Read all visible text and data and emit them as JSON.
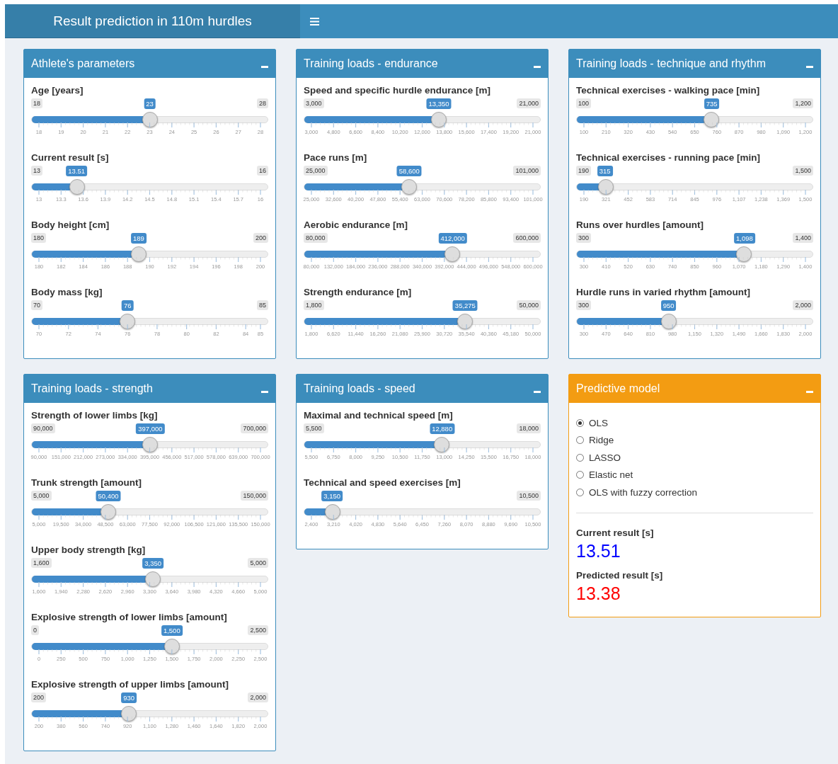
{
  "header": {
    "title": "Result prediction in 110m hurdles"
  },
  "panels": [
    {
      "kind": "sliders",
      "title": "Athlete's parameters",
      "sliders": [
        {
          "label": "Age [years]",
          "min": "18",
          "max": "28",
          "value": "23",
          "level": 0.5,
          "ticks": [
            "18",
            "19",
            "20",
            "21",
            "22",
            "23",
            "24",
            "25",
            "26",
            "27",
            "28"
          ]
        },
        {
          "label": "Current result [s]",
          "min": "13",
          "max": "16",
          "value": "13.51",
          "level": 0.17,
          "ticks": [
            "13",
            "13.3",
            "13.6",
            "13.9",
            "14.2",
            "14.5",
            "14.8",
            "15.1",
            "15.4",
            "15.7",
            "16"
          ]
        },
        {
          "label": "Body height [cm]",
          "min": "180",
          "max": "200",
          "value": "189",
          "level": 0.45,
          "ticks": [
            "180",
            "182",
            "184",
            "186",
            "188",
            "190",
            "192",
            "194",
            "196",
            "198",
            "200"
          ]
        },
        {
          "label": "Body mass [kg]",
          "min": "70",
          "max": "85",
          "value": "76",
          "level": 0.4,
          "ticks": [
            "70",
            "72",
            "74",
            "76",
            "78",
            "80",
            "82",
            "84",
            "85"
          ]
        }
      ]
    },
    {
      "kind": "sliders",
      "title": "Training loads - endurance",
      "sliders": [
        {
          "label": "Speed and specific hurdle endurance [m]",
          "min": "3,000",
          "max": "21,000",
          "value": "13,350",
          "level": 0.575,
          "ticks": [
            "3,000",
            "4,800",
            "6,600",
            "8,400",
            "10,200",
            "12,000",
            "13,800",
            "15,600",
            "17,400",
            "19,200",
            "21,000"
          ]
        },
        {
          "label": "Pace runs [m]",
          "min": "25,000",
          "max": "101,000",
          "value": "58,600",
          "level": 0.442,
          "ticks": [
            "25,000",
            "32,600",
            "40,200",
            "47,800",
            "55,400",
            "63,000",
            "70,600",
            "78,200",
            "85,800",
            "93,400",
            "101,000"
          ]
        },
        {
          "label": "Aerobic endurance [m]",
          "min": "80,000",
          "max": "600,000",
          "value": "412,000",
          "level": 0.638,
          "ticks": [
            "80,000",
            "132,000",
            "184,000",
            "236,000",
            "288,000",
            "340,000",
            "392,000",
            "444,000",
            "496,000",
            "548,000",
            "600,000"
          ]
        },
        {
          "label": "Strength endurance [m]",
          "min": "1,800",
          "max": "50,000",
          "value": "35,275",
          "level": 0.6945,
          "ticks": [
            "1,800",
            "6,620",
            "11,440",
            "16,260",
            "21,080",
            "25,900",
            "30,720",
            "35,540",
            "40,360",
            "45,180",
            "50,000"
          ]
        }
      ]
    },
    {
      "kind": "sliders",
      "title": "Training loads - technique and rhythm",
      "sliders": [
        {
          "label": "Technical exercises - walking pace [min]",
          "min": "100",
          "max": "1,200",
          "value": "735",
          "level": 0.577,
          "ticks": [
            "100",
            "210",
            "320",
            "430",
            "540",
            "650",
            "760",
            "870",
            "980",
            "1,090",
            "1,200"
          ]
        },
        {
          "label": "Technical exercises - running pace [min]",
          "min": "190",
          "max": "1,500",
          "value": "315",
          "level": 0.095,
          "ticks": [
            "190",
            "321",
            "452",
            "583",
            "714",
            "845",
            "976",
            "1,107",
            "1,238",
            "1,369",
            "1,500"
          ]
        },
        {
          "label": "Runs over hurdles [amount]",
          "min": "300",
          "max": "1,400",
          "value": "1,098",
          "level": 0.725,
          "ticks": [
            "300",
            "410",
            "520",
            "630",
            "740",
            "850",
            "960",
            "1,070",
            "1,180",
            "1,290",
            "1,400"
          ]
        },
        {
          "label": "Hurdle runs in varied rhythm [amount]",
          "min": "300",
          "max": "2,000",
          "value": "950",
          "level": 0.382,
          "ticks": [
            "300",
            "470",
            "640",
            "810",
            "980",
            "1,150",
            "1,320",
            "1,490",
            "1,660",
            "1,830",
            "2,000"
          ]
        }
      ]
    },
    {
      "kind": "sliders",
      "title": "Training loads - strength",
      "sliders": [
        {
          "label": "Strength of lower limbs [kg]",
          "min": "90,000",
          "max": "700,000",
          "value": "397,000",
          "level": 0.503,
          "ticks": [
            "90,000",
            "151,000",
            "212,000",
            "273,000",
            "334,000",
            "395,000",
            "456,000",
            "517,000",
            "578,000",
            "639,000",
            "700,000"
          ]
        },
        {
          "label": "Trunk strength [amount]",
          "min": "5,000",
          "max": "150,000",
          "value": "50,400",
          "level": 0.313,
          "ticks": [
            "5,000",
            "19,500",
            "34,000",
            "48,500",
            "63,000",
            "77,500",
            "92,000",
            "106,500",
            "121,000",
            "135,500",
            "150,000"
          ]
        },
        {
          "label": "Upper body strength [kg]",
          "min": "1,600",
          "max": "5,000",
          "value": "3,350",
          "level": 0.515,
          "ticks": [
            "1,600",
            "1,940",
            "2,280",
            "2,620",
            "2,960",
            "3,300",
            "3,640",
            "3,980",
            "4,320",
            "4,660",
            "5,000"
          ]
        },
        {
          "label": "Explosive strength of lower limbs [amount]",
          "min": "0",
          "max": "2,500",
          "value": "1,500",
          "level": 0.6,
          "ticks": [
            "0",
            "250",
            "500",
            "750",
            "1,000",
            "1,250",
            "1,500",
            "1,750",
            "2,000",
            "2,250",
            "2,500"
          ]
        },
        {
          "label": "Explosive strength of upper limbs [amount]",
          "min": "200",
          "max": "2,000",
          "value": "930",
          "level": 0.406,
          "ticks": [
            "200",
            "380",
            "560",
            "740",
            "920",
            "1,100",
            "1,280",
            "1,460",
            "1,640",
            "1,820",
            "2,000"
          ]
        }
      ]
    },
    {
      "kind": "sliders",
      "title": "Training loads - speed",
      "sliders": [
        {
          "label": "Maximal and technical speed [m]",
          "min": "5,500",
          "max": "18,000",
          "value": "12,880",
          "level": 0.59,
          "ticks": [
            "5,500",
            "6,750",
            "8,000",
            "9,250",
            "10,500",
            "11,750",
            "13,000",
            "14,250",
            "15,500",
            "16,750",
            "18,000"
          ]
        },
        {
          "label": "Technical and speed exercises [m]",
          "max": "10,500",
          "value": "3,150",
          "level": 0.093,
          "ticks": [
            "2,400",
            "3,210",
            "4,020",
            "4,830",
            "5,640",
            "6,450",
            "7,260",
            "8,070",
            "8,880",
            "9,690",
            "10,500"
          ]
        }
      ]
    },
    {
      "kind": "model",
      "title": "Predictive model",
      "options": [
        {
          "label": "OLS",
          "selected": true
        },
        {
          "label": "Ridge",
          "selected": false
        },
        {
          "label": "LASSO",
          "selected": false
        },
        {
          "label": "Elastic net",
          "selected": false
        },
        {
          "label": "OLS with fuzzy correction",
          "selected": false
        }
      ],
      "results": [
        {
          "label": "Current result [s]",
          "value": "13.51",
          "color": "#0000ff"
        },
        {
          "label": "Predicted result [s]",
          "value": "13.38",
          "color": "#ff0000"
        }
      ]
    }
  ]
}
